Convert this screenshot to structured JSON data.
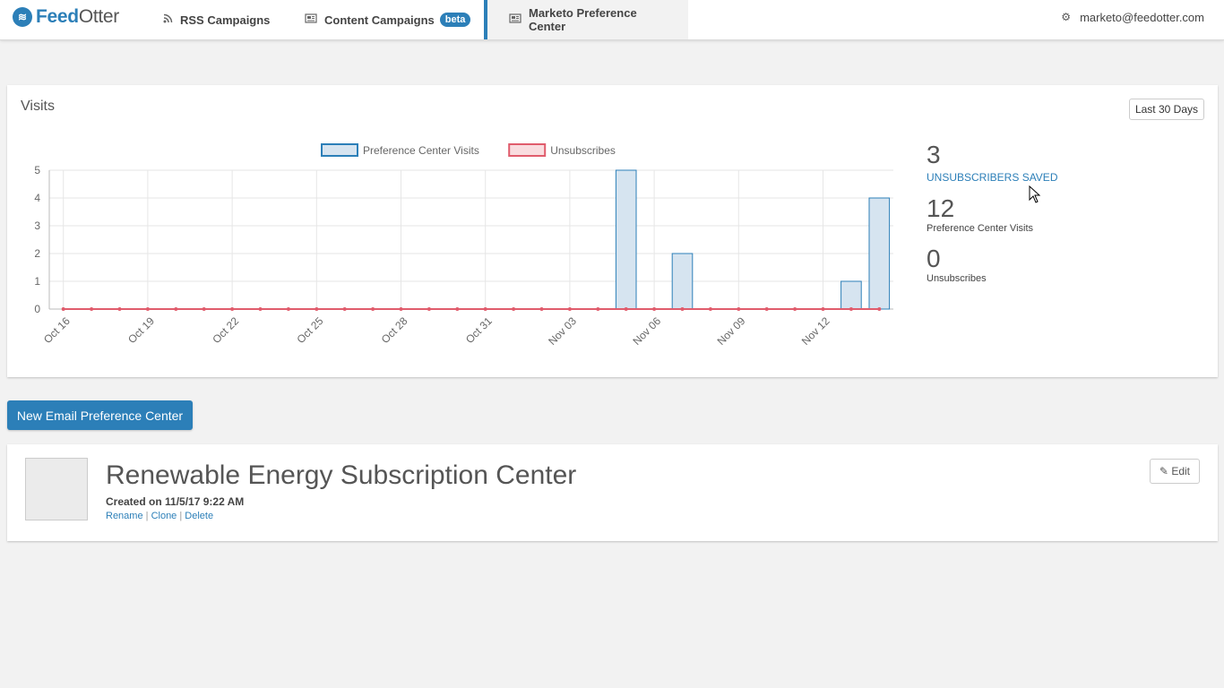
{
  "nav": {
    "logo_text_a": "Feed",
    "logo_text_b": "Otter",
    "logo_icon": "waves-icon",
    "rss_label": "RSS Campaigns",
    "content_label": "Content Campaigns",
    "content_badge": "beta",
    "marketo_label": "Marketo Preference Center",
    "user_email": "marketo@feedotter.com"
  },
  "visits": {
    "title": "Visits",
    "range_label": "Last 30 Days"
  },
  "stats": [
    {
      "value": "3",
      "label": "UNSUBSCRIBERS SAVED",
      "link": true
    },
    {
      "value": "12",
      "label": "Preference Center Visits",
      "link": false
    },
    {
      "value": "0",
      "label": "Unsubscribes",
      "link": false
    }
  ],
  "chart_data": {
    "type": "bar",
    "title": "",
    "xlabel": "",
    "ylabel": "",
    "ylim": [
      0,
      5
    ],
    "yticks": [
      0,
      1,
      2,
      3,
      4,
      5
    ],
    "categories": [
      "Oct 16",
      "Oct 17",
      "Oct 18",
      "Oct 19",
      "Oct 20",
      "Oct 21",
      "Oct 22",
      "Oct 23",
      "Oct 24",
      "Oct 25",
      "Oct 26",
      "Oct 27",
      "Oct 28",
      "Oct 29",
      "Oct 30",
      "Oct 31",
      "Nov 01",
      "Nov 02",
      "Nov 03",
      "Nov 04",
      "Nov 05",
      "Nov 06",
      "Nov 07",
      "Nov 08",
      "Nov 09",
      "Nov 10",
      "Nov 11",
      "Nov 12",
      "Nov 13",
      "Nov 14"
    ],
    "tick_labels": [
      "Oct 16",
      "Oct 19",
      "Oct 22",
      "Oct 25",
      "Oct 28",
      "Oct 31",
      "Nov 03",
      "Nov 06",
      "Nov 09",
      "Nov 12"
    ],
    "legend_position": "top",
    "grid": true,
    "series": [
      {
        "name": "Preference Center Visits",
        "type": "bar",
        "color": "#2c7fb8",
        "fill": "#d6e4f0",
        "values": [
          0,
          0,
          0,
          0,
          0,
          0,
          0,
          0,
          0,
          0,
          0,
          0,
          0,
          0,
          0,
          0,
          0,
          0,
          0,
          0,
          5,
          0,
          2,
          0,
          0,
          0,
          0,
          0,
          1,
          4
        ]
      },
      {
        "name": "Unsubscribes",
        "type": "line",
        "color": "#e05c6c",
        "fill": "#f9dcdf",
        "values": [
          0,
          0,
          0,
          0,
          0,
          0,
          0,
          0,
          0,
          0,
          0,
          0,
          0,
          0,
          0,
          0,
          0,
          0,
          0,
          0,
          0,
          0,
          0,
          0,
          0,
          0,
          0,
          0,
          0,
          0
        ]
      }
    ]
  },
  "new_button_label": "New Email Preference Center",
  "center": {
    "name": "Renewable Energy Subscription Center",
    "created": "Created on 11/5/17 9:22 AM",
    "link_rename": "Rename",
    "link_clone": "Clone",
    "link_delete": "Delete",
    "separator": "|",
    "edit_label": "Edit"
  }
}
